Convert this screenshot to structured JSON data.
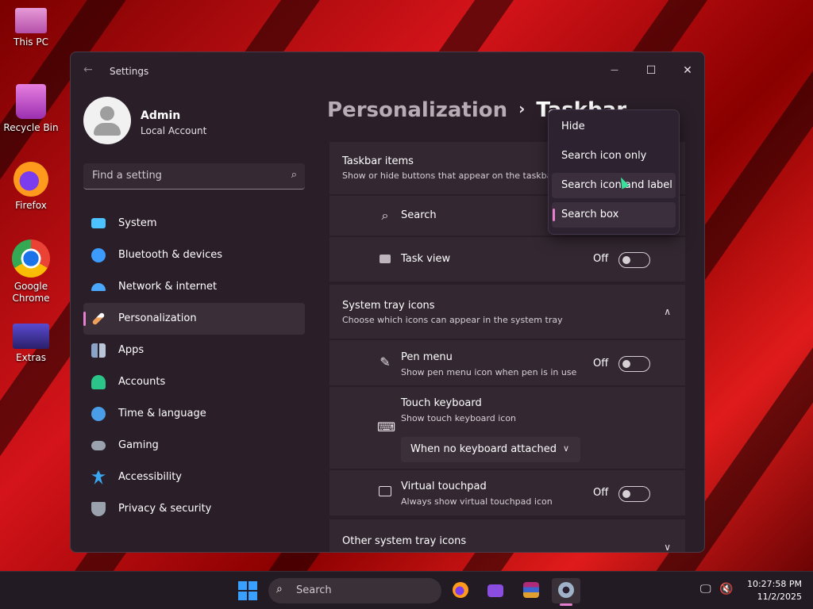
{
  "desktop": {
    "icons": [
      {
        "label": "This PC",
        "icon": "monitor-icon"
      },
      {
        "label": "Recycle Bin",
        "icon": "recycle-bin-icon"
      },
      {
        "label": "Firefox",
        "icon": "firefox-icon"
      },
      {
        "label": "Google Chrome",
        "icon": "chrome-icon"
      },
      {
        "label": "Extras",
        "icon": "extras-icon"
      }
    ]
  },
  "window": {
    "title": "Settings",
    "back": "←",
    "minimize": "—",
    "maximize": "☐",
    "close": "✕"
  },
  "profile": {
    "name": "Admin",
    "account": "Local Account"
  },
  "search": {
    "placeholder": "Find a setting",
    "icon": "search-icon"
  },
  "nav": [
    {
      "label": "System",
      "icon": "system-icon",
      "color": "#4cc2ff"
    },
    {
      "label": "Bluetooth & devices",
      "icon": "bluetooth-icon",
      "color": "#3b9bff"
    },
    {
      "label": "Network & internet",
      "icon": "wifi-icon",
      "color": "#4aa8ff"
    },
    {
      "label": "Personalization",
      "icon": "brush-icon",
      "color": "#f0a05a",
      "active": true
    },
    {
      "label": "Apps",
      "icon": "apps-icon",
      "color": "#8aa4c8"
    },
    {
      "label": "Accounts",
      "icon": "accounts-icon",
      "color": "#2bc58a"
    },
    {
      "label": "Time & language",
      "icon": "globe-icon",
      "color": "#4a9ee8"
    },
    {
      "label": "Gaming",
      "icon": "gaming-icon",
      "color": "#9aa3ad"
    },
    {
      "label": "Accessibility",
      "icon": "accessibility-icon",
      "color": "#3aa7f0"
    },
    {
      "label": "Privacy & security",
      "icon": "shield-icon",
      "color": "#9aa3ad"
    }
  ],
  "breadcrumb": {
    "parent": "Personalization",
    "separator": "›",
    "current": "Taskbar"
  },
  "taskbar_items": {
    "title": "Taskbar items",
    "subtitle": "Show or hide buttons that appear on the taskba",
    "search_label": "Search",
    "task_view_label": "Task view",
    "task_view_state": "Off"
  },
  "tray_icons": {
    "title": "System tray icons",
    "subtitle": "Choose which icons can appear in the system tray",
    "pen_title": "Pen menu",
    "pen_sub": "Show pen menu icon when pen is in use",
    "pen_state": "Off",
    "touch_title": "Touch keyboard",
    "touch_sub": "Show touch keyboard icon",
    "touch_value": "When no keyboard attached",
    "touchpad_title": "Virtual touchpad",
    "touchpad_sub": "Always show virtual touchpad icon",
    "touchpad_state": "Off"
  },
  "other_tray": {
    "title": "Other system tray icons"
  },
  "dropdown_popup": {
    "options": [
      "Hide",
      "Search icon only",
      "Search icon and label",
      "Search box"
    ],
    "selected": "Search box"
  },
  "taskbar": {
    "search_placeholder": "Search",
    "time": "10:27:58 PM",
    "date": "11/2/2025"
  }
}
